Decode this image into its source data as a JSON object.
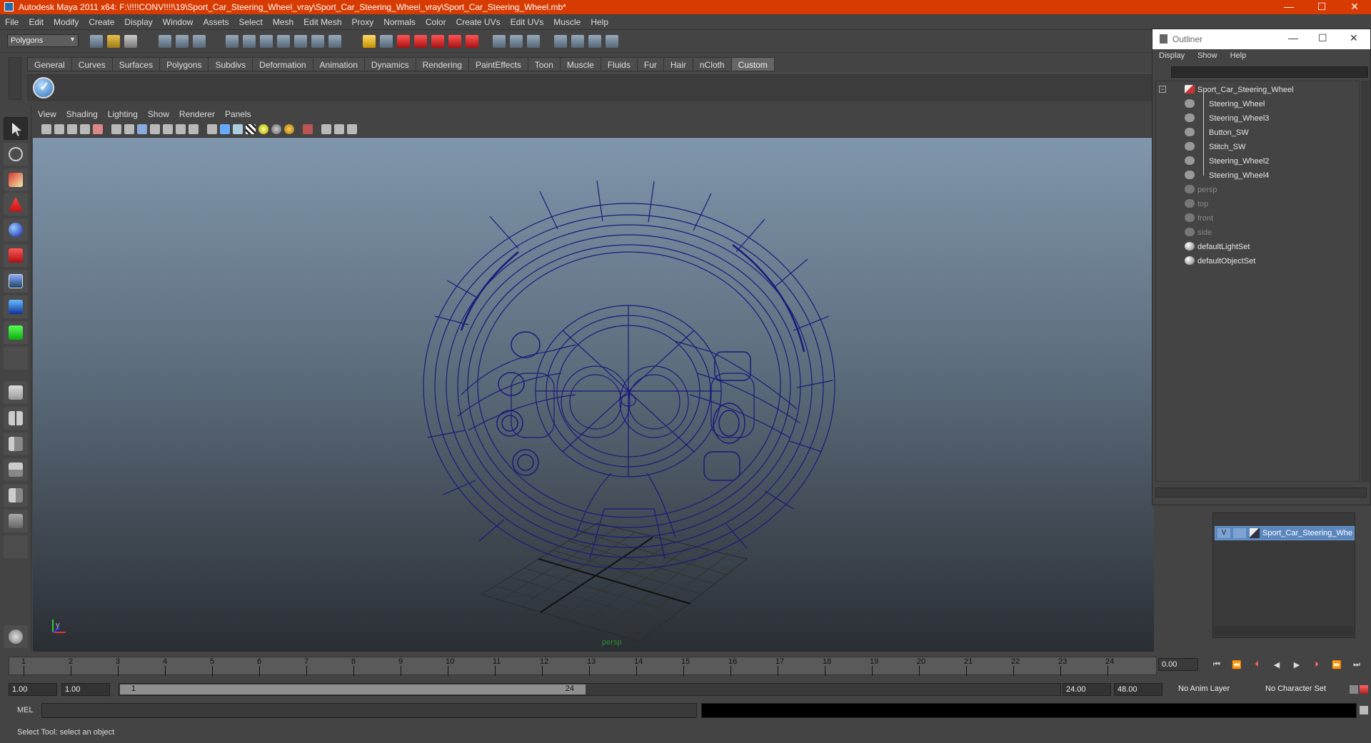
{
  "window": {
    "title": "Autodesk Maya 2011 x64: F:\\!!!!CONV!!!!\\19\\Sport_Car_Steering_Wheel_vray\\Sport_Car_Steering_Wheel_vray\\Sport_Car_Steering_Wheel.mb*",
    "minimize": "—",
    "maximize": "☐",
    "close": "✕"
  },
  "menubar": [
    "File",
    "Edit",
    "Modify",
    "Create",
    "Display",
    "Window",
    "Assets",
    "Select",
    "Mesh",
    "Edit Mesh",
    "Proxy",
    "Normals",
    "Color",
    "Create UVs",
    "Edit UVs",
    "Muscle",
    "Help"
  ],
  "status_line": {
    "mode": "Polygons"
  },
  "shelf": {
    "tabs": [
      "General",
      "Curves",
      "Surfaces",
      "Polygons",
      "Subdivs",
      "Deformation",
      "Animation",
      "Dynamics",
      "Rendering",
      "PaintEffects",
      "Toon",
      "Muscle",
      "Fluids",
      "Fur",
      "Hair",
      "nCloth",
      "Custom"
    ],
    "active_tab": "Custom"
  },
  "panel": {
    "menu": [
      "View",
      "Shading",
      "Lighting",
      "Show",
      "Renderer",
      "Panels"
    ],
    "camera": "persp",
    "axis_label_y": "y",
    "axis_label_x": "x"
  },
  "outliner": {
    "title": "Outliner",
    "menu": [
      "Display",
      "Show",
      "Help"
    ],
    "items": [
      {
        "label": "Sport_Car_Steering_Wheel",
        "level": 0,
        "dim": false
      },
      {
        "label": "Steering_Wheel",
        "level": 1,
        "dim": false
      },
      {
        "label": "Steering_Wheel3",
        "level": 1,
        "dim": false
      },
      {
        "label": "Button_SW",
        "level": 1,
        "dim": false
      },
      {
        "label": "Stitch_SW",
        "level": 1,
        "dim": false
      },
      {
        "label": "Steering_Wheel2",
        "level": 1,
        "dim": false
      },
      {
        "label": "Steering_Wheel4",
        "level": 1,
        "dim": false
      },
      {
        "label": "persp",
        "level": 0,
        "dim": true
      },
      {
        "label": "top",
        "level": 0,
        "dim": true
      },
      {
        "label": "front",
        "level": 0,
        "dim": true
      },
      {
        "label": "side",
        "level": 0,
        "dim": true
      },
      {
        "label": "defaultLightSet",
        "level": 0,
        "dim": false
      },
      {
        "label": "defaultObjectSet",
        "level": 0,
        "dim": false
      }
    ]
  },
  "layer_editor": {
    "layer_name": "Sport_Car_Steering_Whe",
    "visible_flag": "V"
  },
  "time_slider": {
    "ticks": [
      "1",
      "2",
      "3",
      "4",
      "5",
      "6",
      "7",
      "8",
      "9",
      "10",
      "11",
      "12",
      "13",
      "14",
      "15",
      "16",
      "17",
      "18",
      "19",
      "20",
      "21",
      "22",
      "23",
      "24"
    ],
    "current_time": "0.00",
    "playback_icons": [
      "⏮",
      "⏪",
      "⏴",
      "◀",
      "▶",
      "⏵",
      "⏩",
      "⏭"
    ]
  },
  "range_slider": {
    "start_time": "1.00",
    "playback_start": "1.00",
    "handle_start": "1",
    "handle_end": "24",
    "playback_end": "24.00",
    "end_time": "48.00",
    "anim_layer": "No Anim Layer",
    "character_set": "No Character Set"
  },
  "command_line": {
    "label": "MEL"
  },
  "help_line": {
    "text": "Select Tool: select an object"
  },
  "colors": {
    "title_bar": "#d83b01",
    "wireframe": "#1a1a7a",
    "viewport_top": "#8096ac",
    "viewport_bottom": "#2a2e33"
  }
}
